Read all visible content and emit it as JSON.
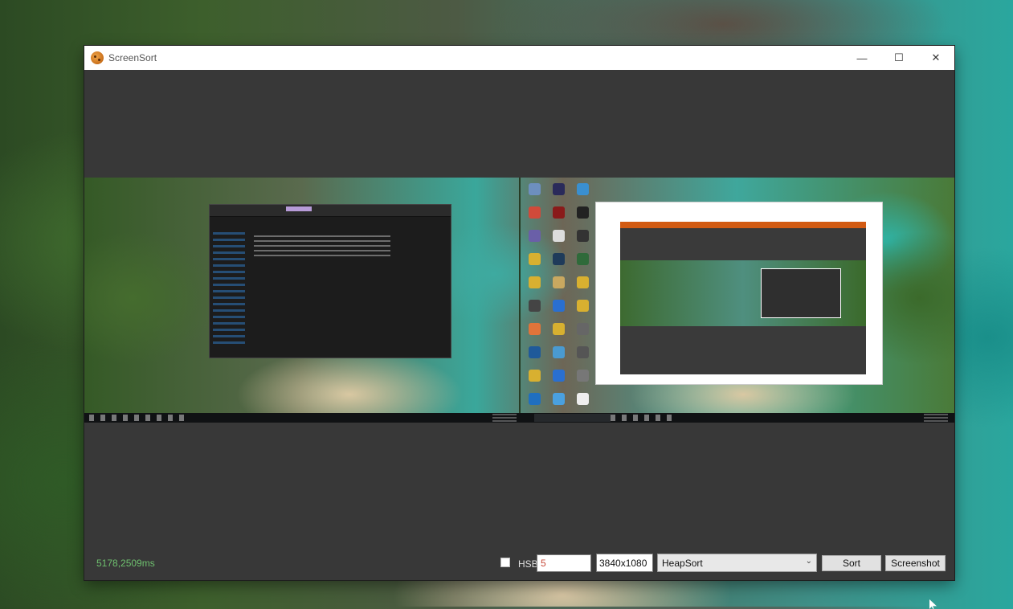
{
  "window": {
    "title": "ScreenSort",
    "controls": {
      "minimize": "—",
      "maximize": "☐",
      "close": "✕"
    }
  },
  "footer": {
    "timing": "5178,2509ms",
    "hsb_label": "HSB",
    "hsb_checked": false,
    "number_value": "5",
    "resolution_value": "3840x1080",
    "algorithm_selected": "HeapSort",
    "sort_label": "Sort",
    "screenshot_label": "Screenshot"
  },
  "colors": {
    "window_bg": "#383838",
    "timing_text": "#6fc16f",
    "number_text": "#c74a3a",
    "titlebar": "#ffffff"
  }
}
